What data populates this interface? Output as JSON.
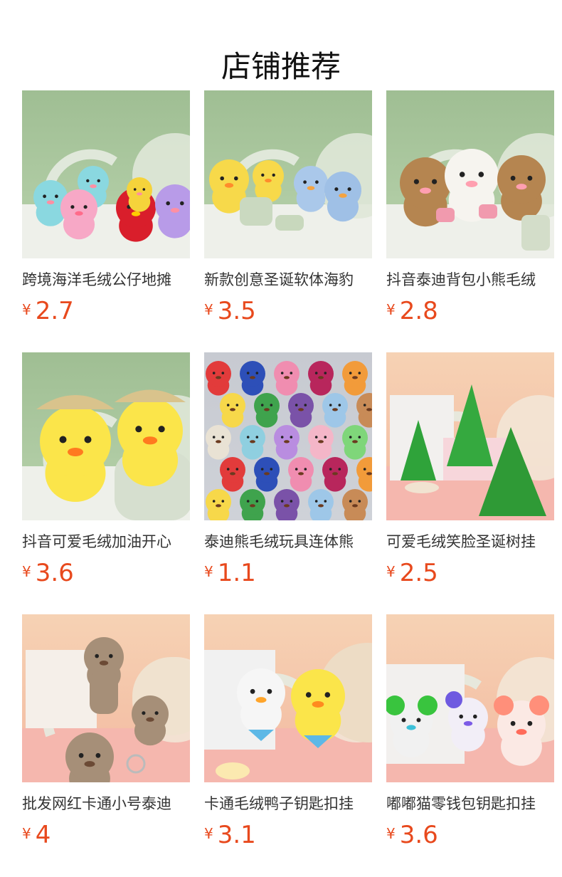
{
  "section": {
    "title": "店铺推荐"
  },
  "currency_symbol": "¥",
  "products": [
    {
      "name": "跨境海洋毛绒公仔地摊",
      "price": "2.7",
      "theme": "green",
      "icon": "crab-plush-image"
    },
    {
      "name": "新款创意圣诞软体海豹",
      "price": "3.5",
      "theme": "green",
      "icon": "penguin-plush-image"
    },
    {
      "name": "抖音泰迪背包小熊毛绒",
      "price": "2.8",
      "theme": "green",
      "icon": "teddy-bear-plush-image"
    },
    {
      "name": "抖音可爱毛绒加油开心",
      "price": "3.6",
      "theme": "green",
      "icon": "yellow-duck-plush-image"
    },
    {
      "name": "泰迪熊毛绒玩具连体熊",
      "price": "1.1",
      "theme": "gray",
      "icon": "colorful-bears-image"
    },
    {
      "name": "可爱毛绒笑脸圣诞树挂",
      "price": "2.5",
      "theme": "peach",
      "icon": "christmas-tree-plush-image"
    },
    {
      "name": "批发网红卡通小号泰迪",
      "price": "4",
      "theme": "peach",
      "icon": "brown-bear-keychain-image"
    },
    {
      "name": "卡通毛绒鸭子钥匙扣挂",
      "price": "3.1",
      "theme": "peach",
      "icon": "sailor-duck-plush-image"
    },
    {
      "name": "嘟嘟猫零钱包钥匙扣挂",
      "price": "3.6",
      "theme": "peach",
      "icon": "cat-coin-purse-image"
    }
  ],
  "colors": {
    "price": "#e8491d",
    "title": "#111111",
    "green_bg": "#a7c59a",
    "peach_bg": "#f4c9a8",
    "gray_bg": "#c9ccd3"
  }
}
